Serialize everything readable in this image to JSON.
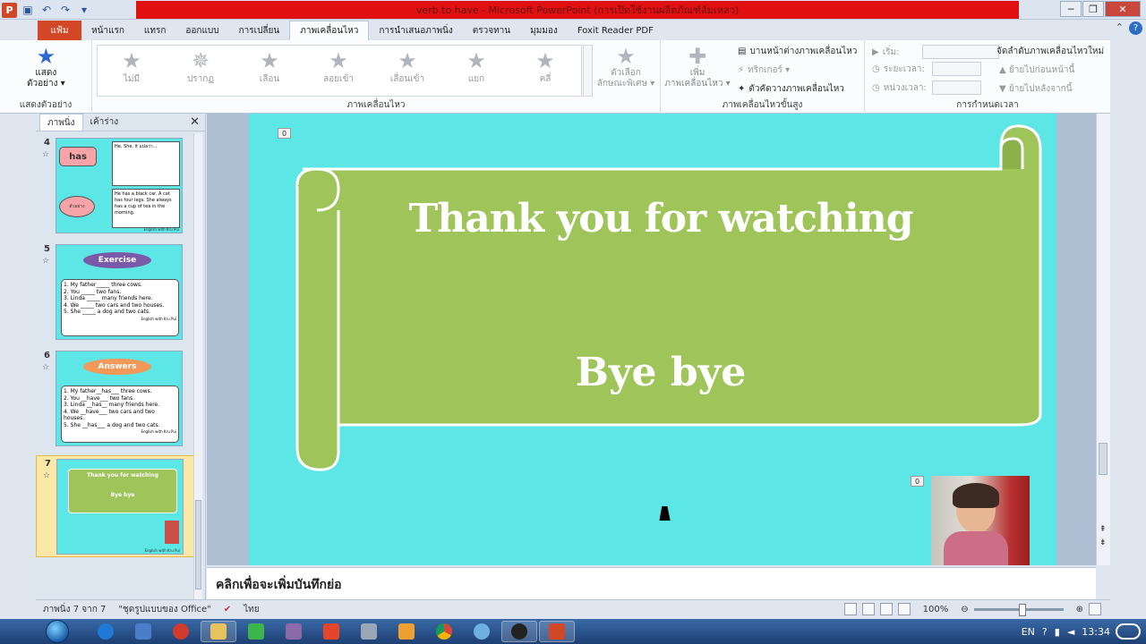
{
  "window": {
    "title": "verb to have - Microsoft PowerPoint (การเปิดใช้งานผลิตภัณฑ์ล้มเหลว)",
    "min_label": "─",
    "max_label": "❐",
    "close_label": "✕"
  },
  "qat": {
    "undo": "↶",
    "redo": "↷",
    "more": "▾"
  },
  "tabs": [
    {
      "label": "แฟ้ม"
    },
    {
      "label": "หน้าแรก"
    },
    {
      "label": "แทรก"
    },
    {
      "label": "ออกแบบ"
    },
    {
      "label": "การเปลี่ยน"
    },
    {
      "label": "ภาพเคลื่อนไหว"
    },
    {
      "label": "การนำเสนอภาพนิ่ง"
    },
    {
      "label": "ตรวจทาน"
    },
    {
      "label": "มุมมอง"
    },
    {
      "label": "Foxit Reader PDF"
    }
  ],
  "ribbon": {
    "preview": {
      "label1": "แสดง",
      "label2": "ตัวอย่าง ▾",
      "group": "แสดงตัวอย่าง"
    },
    "gallery": {
      "items": [
        "ไม่มี",
        "ปรากฏ",
        "เลือน",
        "ลอยเข้า",
        "เลื่อนเข้า",
        "แยก",
        "คลี่"
      ],
      "effects1": "ตัวเลือก",
      "effects2": "ลักษณะพิเศษ ▾",
      "group": "ภาพเคลื่อนไหว"
    },
    "advanced": {
      "add1": "เพิ่ม",
      "add2": "ภาพเคลื่อนไหว ▾",
      "pane": "บานหน้าต่างภาพเคลื่อนไหว",
      "trigger": "ทริกเกอร์ ▾",
      "painter": "ตัวคัดวางภาพเคลื่อนไหว",
      "group": "ภาพเคลื่อนไหวขั้นสูง"
    },
    "timing": {
      "start": "เริ่ม:",
      "duration": "ระยะเวลา:",
      "delay": "หน่วงเวลา:",
      "reorder": "จัดลำดับภาพเคลื่อนไหวใหม่",
      "earlier": "▲ ย้ายไปก่อนหน้านี้",
      "later": "▼ ย้ายไปหลังจากนี้",
      "group": "การกำหนดเวลา"
    }
  },
  "panel": {
    "tab_slides": "ภาพนิ่ง",
    "tab_outline": "เค้าร่าง",
    "close": "✕",
    "thumbs": [
      {
        "num": "4",
        "title": "has",
        "circle": "ตัวอย่าง",
        "box1": "He, She, it แปลว่า...",
        "box2": "He has a black car. A cat has four legs. She always has a cup of tea in the morning.",
        "footer": "English with Kru Pui"
      },
      {
        "num": "5",
        "title": "Exercise",
        "lines": [
          "1. My father_____ three cows.",
          "2. You _____ two fans.",
          "3. Linda _____ many friends here.",
          "4. We _____ two cars and two houses.",
          "5. She _____ a dog and two cats."
        ],
        "footer": "English with Kru Pui"
      },
      {
        "num": "6",
        "title": "Answers",
        "lines": [
          "1. My father__has___ three cows.",
          "2. You __have___ two fans.",
          "3. Linda __has__ many friends here.",
          "4. We __have___ two cars and two houses.",
          "5. She __has___ a dog and two cats."
        ],
        "footer": "English with Kru Pui"
      },
      {
        "num": "7",
        "title": "Thank you for watching",
        "bye": "Bye bye",
        "footer": "English with Kru Pui"
      }
    ]
  },
  "slide": {
    "title": "Thank you for watching",
    "bye": "Bye bye",
    "anim_tag_1": "0",
    "anim_tag_2": "0",
    "colors": {
      "background": "#5de6e6",
      "scroll": "#9ec45a",
      "text": "#ffffff"
    }
  },
  "notes": {
    "placeholder": "คลิกเพื่อจะเพิ่มบันทึกย่อ"
  },
  "status": {
    "slide_info": "ภาพนิ่ง 7 จาก 7",
    "theme": "\"ชุดรูปแบบของ Office\"",
    "language": "ไทย",
    "zoom": "100%"
  },
  "taskbar": {
    "tray_lang": "EN",
    "time": "13:34"
  }
}
